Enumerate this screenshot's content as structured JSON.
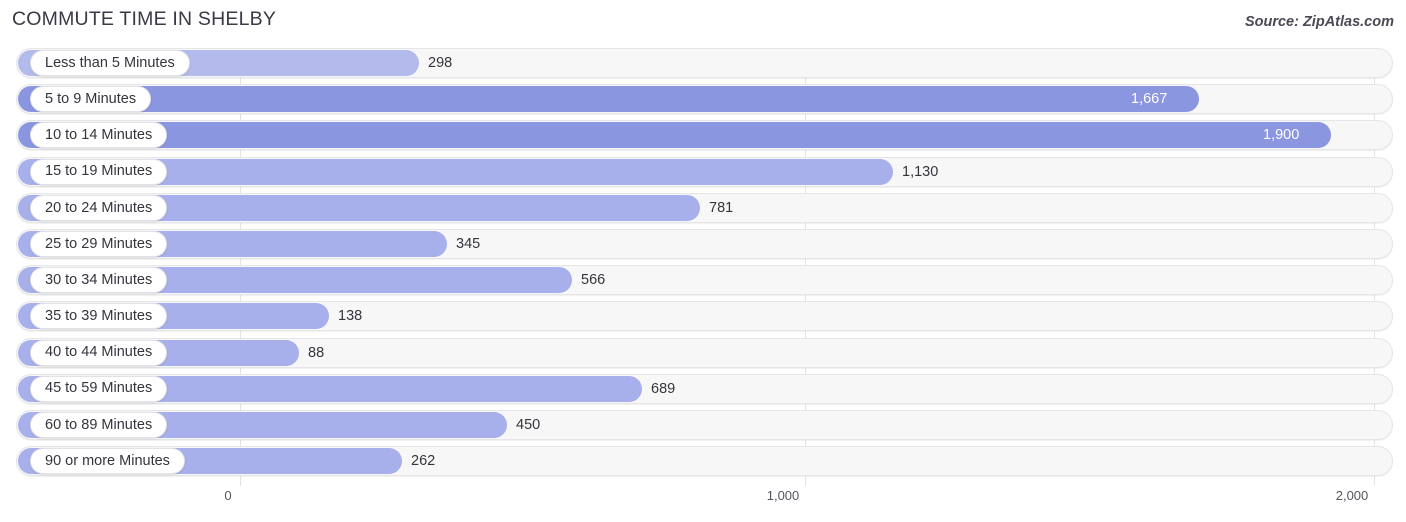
{
  "header": {
    "title": "COMMUTE TIME IN SHELBY",
    "source": "Source: ZipAtlas.com"
  },
  "chart_data": {
    "type": "bar",
    "orientation": "horizontal",
    "title": "COMMUTE TIME IN SHELBY",
    "xlabel": "",
    "ylabel": "",
    "xlim": [
      0,
      2000
    ],
    "grid": true,
    "legend": null,
    "xticks": [
      "0",
      "1,000",
      "2,000"
    ],
    "xtick_values": [
      0,
      1000,
      2000
    ],
    "categories": [
      "Less than 5 Minutes",
      "5 to 9 Minutes",
      "10 to 14 Minutes",
      "15 to 19 Minutes",
      "20 to 24 Minutes",
      "25 to 29 Minutes",
      "30 to 34 Minutes",
      "35 to 39 Minutes",
      "40 to 44 Minutes",
      "45 to 59 Minutes",
      "60 to 89 Minutes",
      "90 or more Minutes"
    ],
    "values": [
      298,
      1667,
      1900,
      1130,
      781,
      345,
      566,
      138,
      88,
      689,
      450,
      262
    ],
    "value_labels": [
      "298",
      "1,667",
      "1,900",
      "1,130",
      "781",
      "345",
      "566",
      "138",
      "88",
      "689",
      "450",
      "262"
    ],
    "bar_color": "#8b96e0",
    "bar_color_light": "#b3bbed",
    "track_color": "#f7f7f8"
  },
  "rows": [
    {
      "label": "Less than 5 Minutes",
      "value_label": "298",
      "end": 419,
      "shade": "light",
      "inside": false
    },
    {
      "label": "5 to 9 Minutes",
      "value_label": "1,667",
      "end": 1199,
      "shade": "dark",
      "inside": true
    },
    {
      "label": "10 to 14 Minutes",
      "value_label": "1,900",
      "end": 1331,
      "shade": "dark",
      "inside": true
    },
    {
      "label": "15 to 19 Minutes",
      "value_label": "1,130",
      "end": 893,
      "shade": "mid",
      "inside": false
    },
    {
      "label": "20 to 24 Minutes",
      "value_label": "781",
      "end": 700,
      "shade": "mid",
      "inside": false
    },
    {
      "label": "25 to 29 Minutes",
      "value_label": "345",
      "end": 447,
      "shade": "mid",
      "inside": false
    },
    {
      "label": "30 to 34 Minutes",
      "value_label": "566",
      "end": 572,
      "shade": "mid",
      "inside": false
    },
    {
      "label": "35 to 39 Minutes",
      "value_label": "138",
      "end": 329,
      "shade": "mid",
      "inside": false
    },
    {
      "label": "40 to 44 Minutes",
      "value_label": "88",
      "end": 299,
      "shade": "mid",
      "inside": false
    },
    {
      "label": "45 to 59 Minutes",
      "value_label": "689",
      "end": 642,
      "shade": "mid",
      "inside": false
    },
    {
      "label": "60 to 89 Minutes",
      "value_label": "450",
      "end": 507,
      "shade": "mid",
      "inside": false
    },
    {
      "label": "90 or more Minutes",
      "value_label": "262",
      "end": 402,
      "shade": "mid",
      "inside": false
    }
  ],
  "axis": {
    "ticks": [
      {
        "text": "0",
        "x": 228
      },
      {
        "text": "1,000",
        "x": 783
      },
      {
        "text": "2,000",
        "x": 1352
      }
    ],
    "gridlines_x": [
      240,
      805,
      1374
    ]
  }
}
